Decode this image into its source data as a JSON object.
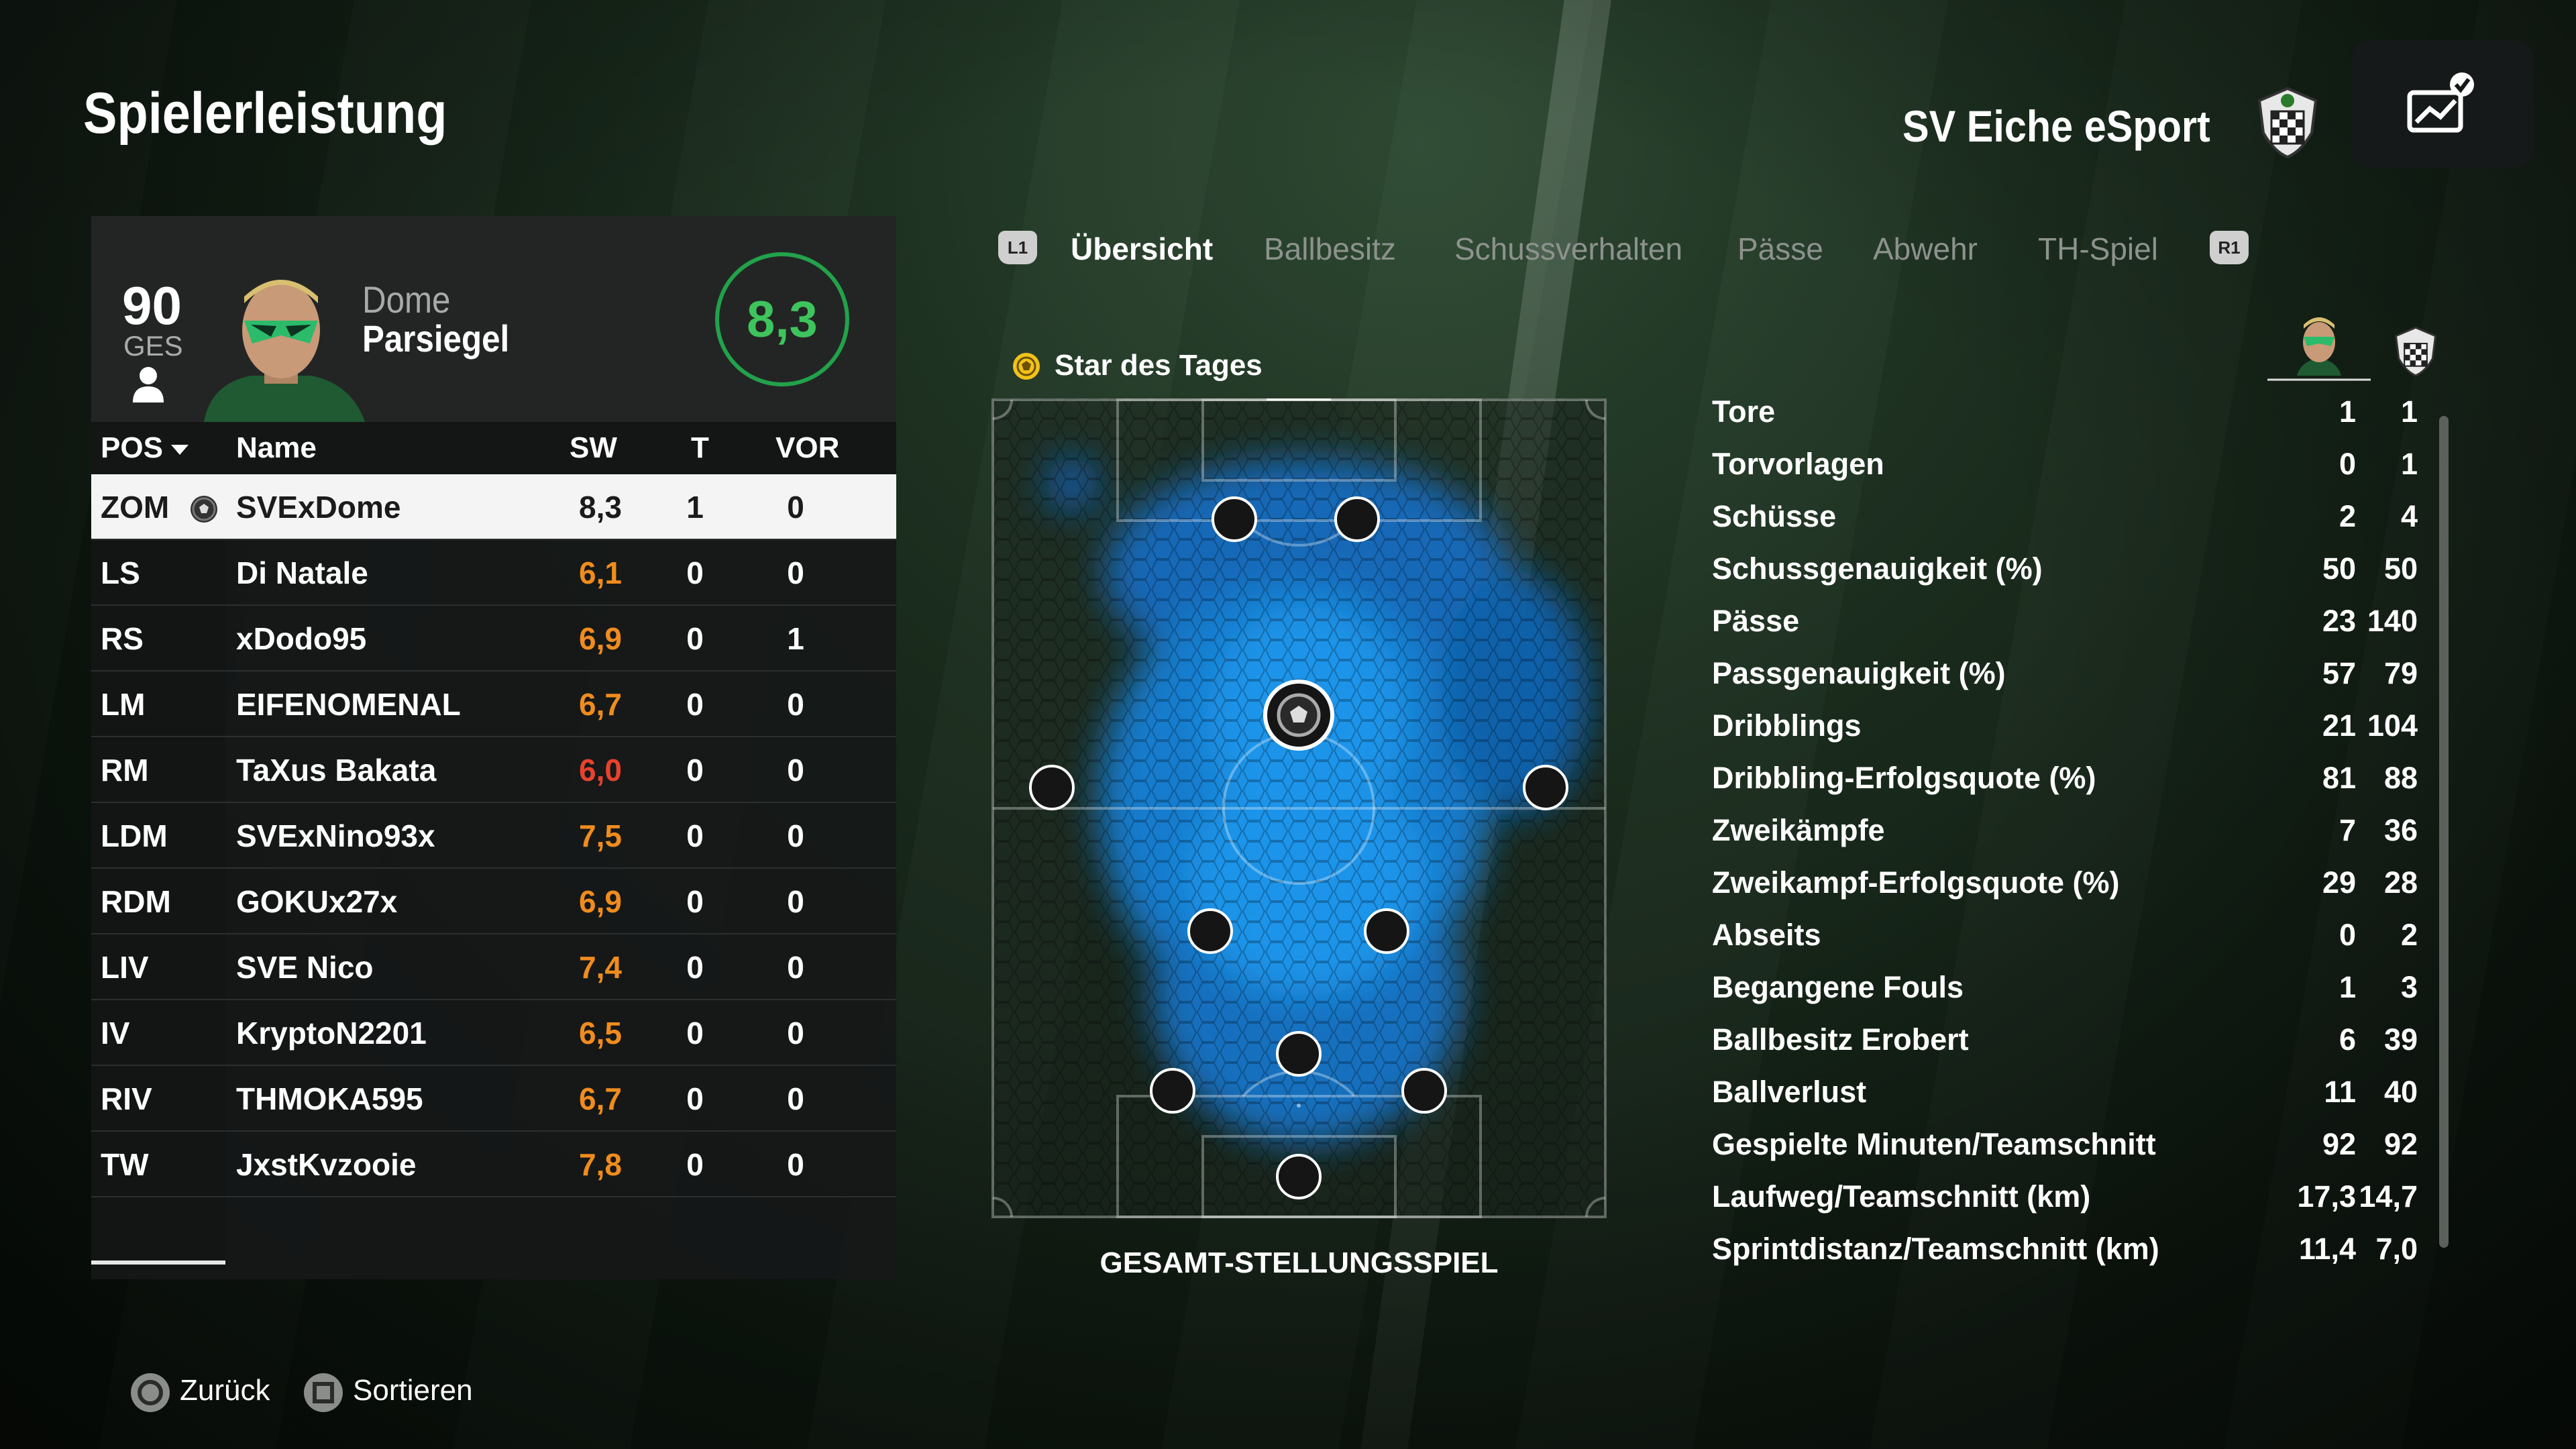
{
  "page": {
    "title": "Spielerleistung"
  },
  "club": {
    "name": "SV Eiche eSport",
    "crest_icon": "club-crest-icon",
    "stats_button_icon": "stats-chart-icon"
  },
  "player": {
    "overall": "90",
    "overall_label": "GES",
    "first_name": "Dome",
    "last_name": "Parsiegel",
    "match_rating": "8,3"
  },
  "table": {
    "headers": {
      "pos": "POS",
      "name": "Name",
      "sw": "SW",
      "t": "T",
      "vor": "VOR"
    },
    "rows": [
      {
        "pos": "ZOM",
        "name": "SVExDome",
        "sw": "8,3",
        "t": "1",
        "vor": "0",
        "rating_color": "#1b1b1b",
        "selected": true
      },
      {
        "pos": "LS",
        "name": "Di Natale",
        "sw": "6,1",
        "t": "0",
        "vor": "0",
        "rating_color": "#f08c1e"
      },
      {
        "pos": "RS",
        "name": "xDodo95",
        "sw": "6,9",
        "t": "0",
        "vor": "1",
        "rating_color": "#f08c1e"
      },
      {
        "pos": "LM",
        "name": "EIFENOMENAL",
        "sw": "6,7",
        "t": "0",
        "vor": "0",
        "rating_color": "#f08c1e"
      },
      {
        "pos": "RM",
        "name": "TaXus Bakata",
        "sw": "6,0",
        "t": "0",
        "vor": "0",
        "rating_color": "#e8422e"
      },
      {
        "pos": "LDM",
        "name": "SVExNino93x",
        "sw": "7,5",
        "t": "0",
        "vor": "0",
        "rating_color": "#f08c1e"
      },
      {
        "pos": "RDM",
        "name": "GOKUx27x",
        "sw": "6,9",
        "t": "0",
        "vor": "0",
        "rating_color": "#f08c1e"
      },
      {
        "pos": "LIV",
        "name": "SVE Nico",
        "sw": "7,4",
        "t": "0",
        "vor": "0",
        "rating_color": "#f08c1e"
      },
      {
        "pos": "IV",
        "name": "KryptoN2201",
        "sw": "6,5",
        "t": "0",
        "vor": "0",
        "rating_color": "#f08c1e"
      },
      {
        "pos": "RIV",
        "name": "THMOKA595",
        "sw": "6,7",
        "t": "0",
        "vor": "0",
        "rating_color": "#f08c1e"
      },
      {
        "pos": "TW",
        "name": "JxstKvzooie",
        "sw": "7,8",
        "t": "0",
        "vor": "0",
        "rating_color": "#f08c1e"
      }
    ]
  },
  "tabs": {
    "left_bumper": "L1",
    "right_bumper": "R1",
    "items": [
      "Übersicht",
      "Ballbesitz",
      "Schussverhalten",
      "Pässe",
      "Abwehr",
      "TH-Spiel"
    ],
    "active": "Übersicht"
  },
  "pitch": {
    "badge": "Star des Tages",
    "caption": "GESAMT-STELLUNGSSPIEL",
    "heat_color": "#1aa0ff"
  },
  "stats": {
    "rows": [
      {
        "label": "Tore",
        "player": "1",
        "team": "1"
      },
      {
        "label": "Torvorlagen",
        "player": "0",
        "team": "1"
      },
      {
        "label": "Schüsse",
        "player": "2",
        "team": "4"
      },
      {
        "label": "Schussgenauigkeit (%)",
        "player": "50",
        "team": "50"
      },
      {
        "label": "Pässe",
        "player": "23",
        "team": "140"
      },
      {
        "label": "Passgenauigkeit (%)",
        "player": "57",
        "team": "79"
      },
      {
        "label": "Dribblings",
        "player": "21",
        "team": "104"
      },
      {
        "label": "Dribbling-Erfolgsquote (%)",
        "player": "81",
        "team": "88"
      },
      {
        "label": "Zweikämpfe",
        "player": "7",
        "team": "36"
      },
      {
        "label": "Zweikampf-Erfolgsquote (%)",
        "player": "29",
        "team": "28"
      },
      {
        "label": "Abseits",
        "player": "0",
        "team": "2"
      },
      {
        "label": "Begangene Fouls",
        "player": "1",
        "team": "3"
      },
      {
        "label": "Ballbesitz Erobert",
        "player": "6",
        "team": "39"
      },
      {
        "label": "Ballverlust",
        "player": "11",
        "team": "40"
      },
      {
        "label": "Gespielte Minuten/Teamschnitt",
        "player": "92",
        "team": "92"
      },
      {
        "label": "Laufweg/Teamschnitt (km)",
        "player": "17,3",
        "team": "14,7"
      },
      {
        "label": "Sprintdistanz/Teamschnitt (km)",
        "player": "11,4",
        "team": "7,0"
      }
    ]
  },
  "footer": {
    "back_label": "Zurück",
    "sort_label": "Sortieren"
  },
  "colors": {
    "rating_green": "#3ec45c",
    "rating_orange": "#f08c1e",
    "rating_red": "#e8422e"
  }
}
